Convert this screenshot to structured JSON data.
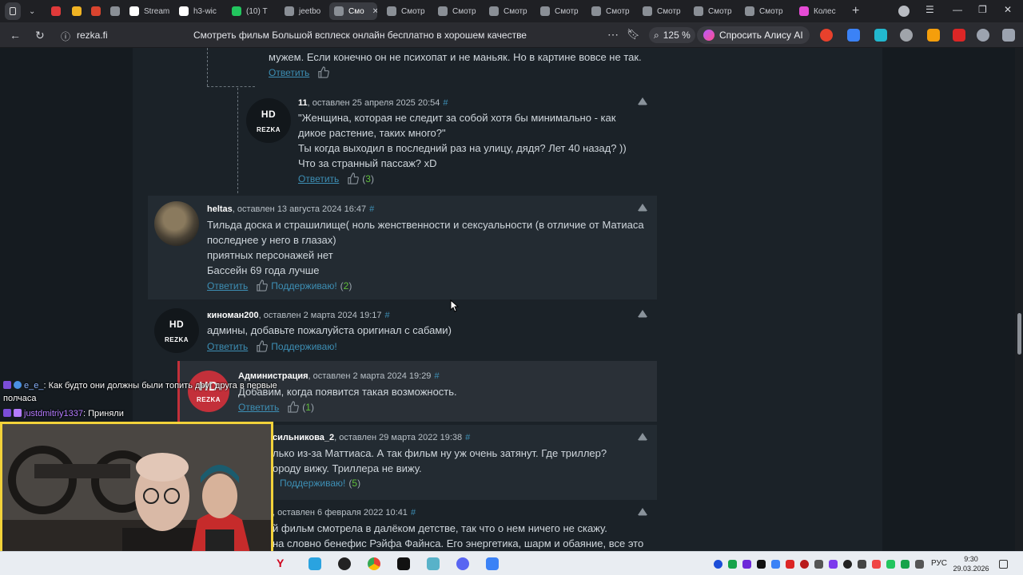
{
  "browser": {
    "tabs": [
      {
        "label": "",
        "color": "#e03a3a"
      },
      {
        "label": "",
        "color": "#f0b323"
      },
      {
        "label": "",
        "color": "#d9442f"
      },
      {
        "label": "",
        "color": "#8a8f96"
      },
      {
        "label": "Stream",
        "color": "#ffffff"
      },
      {
        "label": "h3-wic",
        "color": "#ffffff"
      },
      {
        "label": "(10) Т",
        "color": "#22c55e"
      },
      {
        "label": "jeetbo",
        "color": "#8a8f96"
      },
      {
        "label": "Смо",
        "color": "#8a8f96"
      },
      {
        "label": "Смотр",
        "color": "#8a8f96"
      },
      {
        "label": "Смотр",
        "color": "#8a8f96"
      },
      {
        "label": "Смотр",
        "color": "#8a8f96"
      },
      {
        "label": "Смотр",
        "color": "#8a8f96"
      },
      {
        "label": "Смотр",
        "color": "#8a8f96"
      },
      {
        "label": "Смотр",
        "color": "#8a8f96"
      },
      {
        "label": "Смотр",
        "color": "#8a8f96"
      },
      {
        "label": "Смотр",
        "color": "#8a8f96"
      },
      {
        "label": "Колес",
        "color": "#e64bd6"
      }
    ],
    "url": "rezka.fi",
    "page_title": "Смотреть фильм Большой всплеск онлайн бесплатно в хорошем качестве",
    "zoom": "125 %",
    "alice_label": "Спросить Алису AI"
  },
  "comments": {
    "top_fragment": {
      "text": "мужем. Если конечно он не психопат и не маньяк. Но в картине вовсе не так.",
      "reply": "Ответить"
    },
    "c11": {
      "avatar_l1": "HD",
      "avatar_l2": "REZKA",
      "name": "11",
      "meta": ", оставлен 25 апреля 2025 20:54",
      "hash": "#",
      "lines": [
        "\"Женщина, которая не следит за собой хотя бы минимально - как",
        "дикое растение, таких много?\"",
        "Ты когда выходил в последний раз на улицу, дядя? Лет 40 назад? ))",
        "Что за странный пассаж? xD"
      ],
      "reply": "Ответить",
      "count": "3"
    },
    "heltas": {
      "name": "heltas",
      "meta": ", оставлен 13 августа 2024 16:47",
      "hash": "#",
      "lines": [
        "Тильда доска и страшилище( ноль женственности и сексуальности (в отличие от Матиаса",
        "последнее у него в глазах)",
        "приятных персонажей нет",
        "Бассейн 69 года лучше"
      ],
      "reply": "Ответить",
      "support": "Поддерживаю!",
      "count": "2"
    },
    "kinoman": {
      "avatar_l1": "HD",
      "avatar_l2": "REZKA",
      "name": "киноман200",
      "meta": ", оставлен 2 марта 2024 19:17",
      "hash": "#",
      "lines": [
        "админы, добавьте пожалуйста оригинал с сабами)"
      ],
      "reply": "Ответить",
      "support": "Поддерживаю!"
    },
    "admin": {
      "avatar_l1": "HD",
      "avatar_l2": "REZKA",
      "name": "Администрация",
      "meta": ", оставлен 2 марта 2024 19:29",
      "hash": "#",
      "lines": [
        "Добавим, когда появится такая возможность."
      ],
      "reply": "Ответить",
      "count": "1"
    },
    "silnikova": {
      "name": "сильникова_2",
      "meta": ", оставлен 29 марта 2022 19:38",
      "hash": "#",
      "lines": [
        "лько из-за Маттиаса. А так фильм ну уж очень затянут. Где триллер?",
        "ороду вижу. Триллера не вижу."
      ],
      "support": "Поддерживаю!",
      "count": "5"
    },
    "last": {
      "meta": ", оставлен 6 февраля 2022 10:41",
      "hash": "#",
      "lines": [
        "й фильм смотрела в далёком детстве, так что о нем ничего не скажу.",
        "на словно бенефис Рэйфа Файнса. Его энергетика, шарм и обаяние, все это"
      ]
    }
  },
  "stream_chat": [
    {
      "user": "e_e_",
      "sep": ":",
      "text": "Как будто они должны были топить друг друга в первые"
    },
    {
      "user": "",
      "sep": "",
      "text": "полчаса"
    },
    {
      "user": "justdmitriy1337",
      "sep": ":",
      "text": "Приняли"
    }
  ],
  "taskbar": {
    "lang": "РУС",
    "time": "9:30",
    "date": "29.03.2026"
  }
}
